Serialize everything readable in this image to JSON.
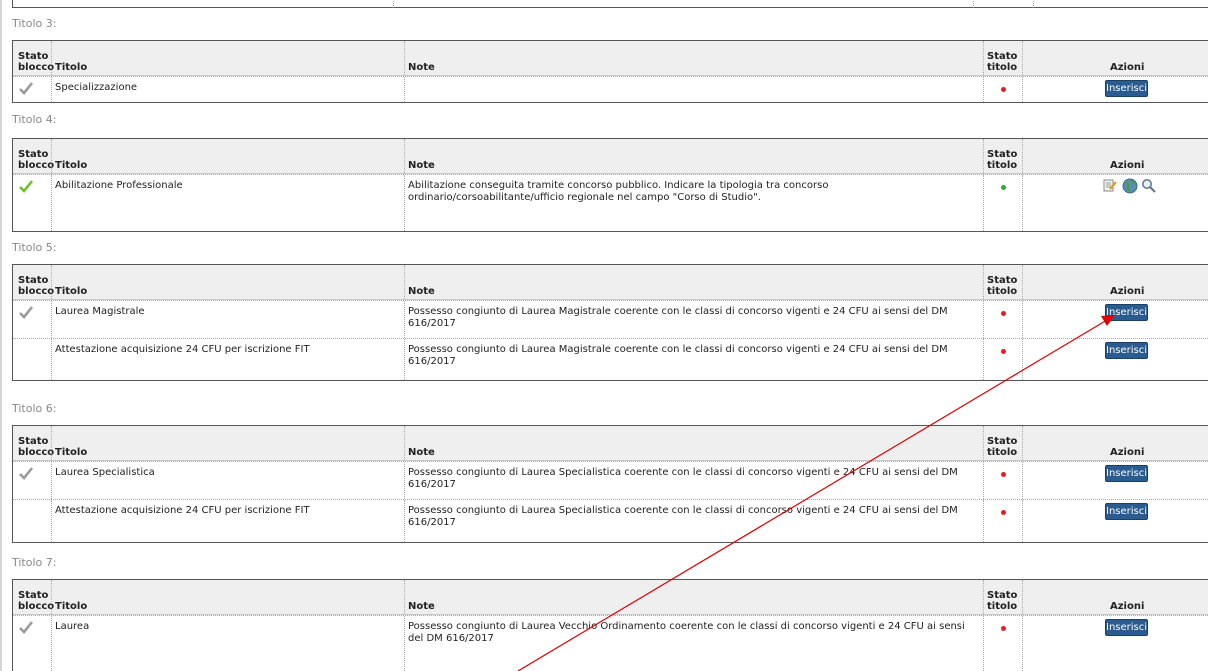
{
  "headers": {
    "stato_blocco_1": "Stato",
    "stato_blocco_2": "blocco",
    "titolo": "Titolo",
    "note": "Note",
    "stato_titolo_1": "Stato",
    "stato_titolo_2": "titolo",
    "azioni": "Azioni"
  },
  "sections": [
    {
      "title": "Titolo 3:",
      "rows": [
        {
          "titolo": "Specializzazione",
          "note": "",
          "blocco": "grey",
          "stato": "red",
          "action": "Inserisci"
        }
      ]
    },
    {
      "title": "Titolo 4:",
      "rows": [
        {
          "titolo": "Abilitazione Professionale",
          "note": "Abilitazione conseguita tramite concorso pubblico. Indicare la tipologia tra concorso ordinario/corsoabilitante/ufficio regionale nel campo \"Corso di Studio\".",
          "blocco": "green",
          "stato": "green",
          "action": "icons"
        }
      ]
    },
    {
      "title": "Titolo 5:",
      "rows": [
        {
          "titolo": "Laurea Magistrale",
          "note": "Possesso congiunto di Laurea Magistrale coerente con le classi di concorso vigenti e 24 CFU ai sensi del DM 616/2017",
          "blocco": "grey",
          "stato": "red",
          "action": "Inserisci"
        },
        {
          "titolo": "Attestazione acquisizione 24 CFU per iscrizione FIT",
          "note": "Possesso congiunto di Laurea Magistrale coerente con le classi di concorso vigenti e 24 CFU ai sensi del DM 616/2017",
          "blocco": "",
          "stato": "red",
          "action": "Inserisci"
        }
      ]
    },
    {
      "title": "Titolo 6:",
      "rows": [
        {
          "titolo": "Laurea Specialistica",
          "note": "Possesso congiunto di Laurea Specialistica coerente con le classi di concorso vigenti e 24 CFU ai sensi del DM 616/2017",
          "blocco": "grey",
          "stato": "red",
          "action": "Inserisci"
        },
        {
          "titolo": "Attestazione acquisizione 24 CFU per iscrizione FIT",
          "note": "Possesso congiunto di Laurea Specialistica coerente con le classi di concorso vigenti e 24 CFU ai sensi del DM 616/2017",
          "blocco": "",
          "stato": "red",
          "action": "Inserisci"
        }
      ]
    },
    {
      "title": "Titolo 7:",
      "rows": [
        {
          "titolo": "Laurea",
          "note": "Possesso congiunto di Laurea Vecchio Ordinamento coerente con le classi di concorso vigenti e 24 CFU ai sensi del DM 616/2017",
          "blocco": "grey",
          "stato": "red",
          "action": "Inserisci"
        }
      ]
    }
  ],
  "icon_names": [
    "edit-icon",
    "globe-icon",
    "search-icon"
  ],
  "colors": {
    "button": "#2a5c91",
    "dot_red": "#e02020",
    "dot_green": "#2ea82e",
    "check_green": "#6cc02a",
    "check_grey": "#9a9a9a",
    "arrow": "#e00000"
  }
}
